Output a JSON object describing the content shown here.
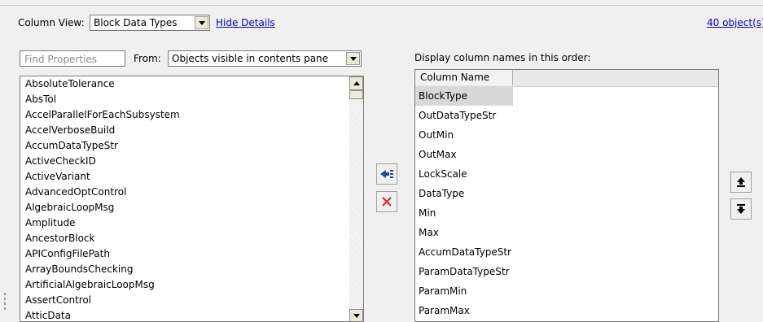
{
  "toolbar": {
    "column_view_label": "Column View:",
    "column_view_value": "Block Data Types",
    "hide_details": "Hide Details",
    "object_count": "40 object(s)"
  },
  "left": {
    "find_placeholder": "Find Properties",
    "from_label": "From:",
    "from_value": "Objects visible in contents pane",
    "properties": [
      "AbsoluteTolerance",
      "AbsTol",
      "AccelParallelForEachSubsystem",
      "AccelVerboseBuild",
      "AccumDataTypeStr",
      "ActiveCheckID",
      "ActiveVariant",
      "AdvancedOptControl",
      "AlgebraicLoopMsg",
      "Amplitude",
      "AncestorBlock",
      "APIConfigFilePath",
      "ArrayBoundsChecking",
      "ArtificialAlgebraicLoopMsg",
      "AssertControl",
      "AtticData"
    ]
  },
  "middle": {
    "add_icon": "add-columns-icon",
    "remove_icon": "remove-icon"
  },
  "right": {
    "instruction": "Display column names in this order:",
    "header": "Column Name",
    "columns": [
      "BlockType",
      "OutDataTypeStr",
      "OutMin",
      "OutMax",
      "LockScale",
      "DataType",
      "Min",
      "Max",
      "AccumDataTypeStr",
      "ParamDataTypeStr",
      "ParamMin",
      "ParamMax"
    ],
    "move_up_icon": "move-up-icon",
    "move_down_icon": "move-down-icon"
  },
  "colors": {
    "link": "#0000cc",
    "remove": "#e02020",
    "add": "#1a4a9a"
  }
}
